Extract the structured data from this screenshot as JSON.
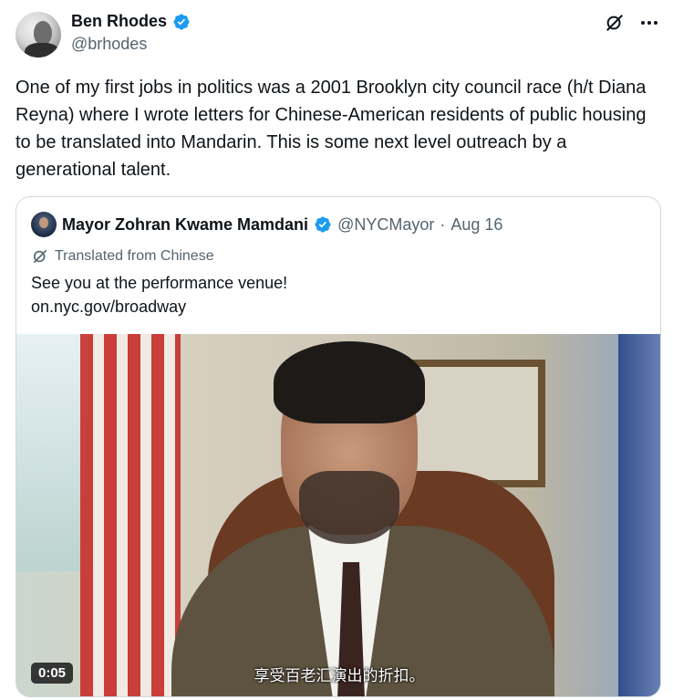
{
  "author": {
    "name": "Ben Rhodes",
    "handle": "@brhodes",
    "verified": true,
    "verified_color": "#1d9bf0"
  },
  "actions": {
    "grok_icon": "grok-icon",
    "more_icon": "more-icon"
  },
  "tweet": {
    "text": "One of my first jobs in politics was a 2001 Brooklyn city council race (h/t Diana Reyna) where I wrote letters for Chinese-American residents of public housing to be translated into Mandarin. This is some next level outreach by a generational talent."
  },
  "quoted": {
    "name": "Mayor Zohran Kwame Mamdani",
    "handle": "@NYCMayor",
    "separator": "·",
    "date": "Aug 16",
    "translated_label": "Translated from Chinese",
    "text_line1": "See you at the performance venue!",
    "text_line2": "on.nyc.gov/broadway",
    "video": {
      "timestamp": "0:05",
      "subtitle": "享受百老汇演出的折扣。"
    }
  }
}
